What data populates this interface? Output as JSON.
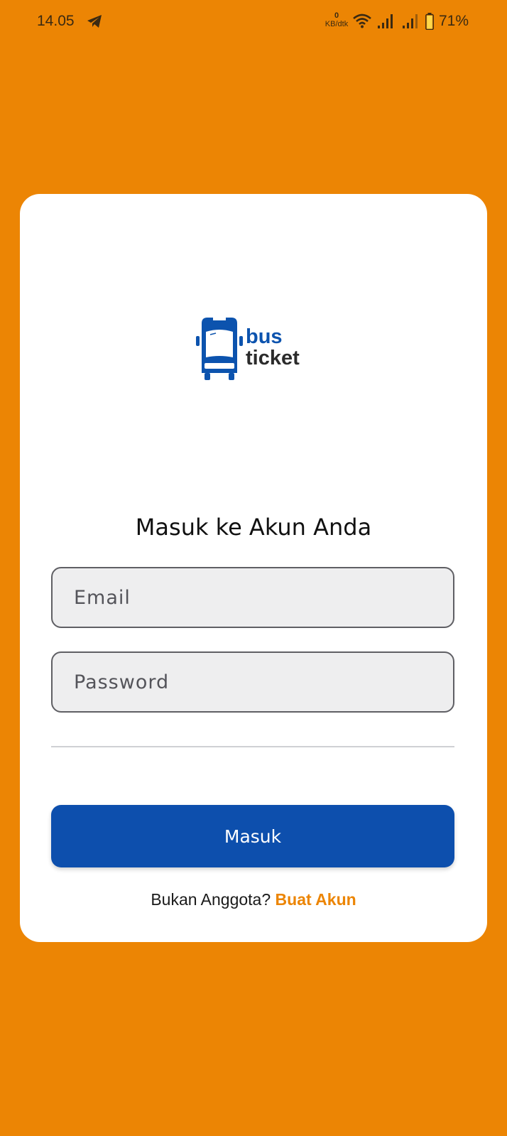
{
  "status_bar": {
    "time": "14.05",
    "net_speed_value": "0",
    "net_speed_unit": "KB/dtk",
    "battery_percent": "71%"
  },
  "logo": {
    "line1": "bus",
    "line2": "ticket",
    "icon": "bus-icon"
  },
  "login": {
    "heading": "Masuk ke Akun Anda",
    "email_placeholder": "Email",
    "password_placeholder": "Password",
    "submit_label": "Masuk",
    "register_prompt": "Bukan Anggota?",
    "register_link": "Buat Akun"
  },
  "colors": {
    "background": "#EC8504",
    "card": "#FFFFFF",
    "primary": "#0D4FAD",
    "accent": "#EC8504"
  }
}
